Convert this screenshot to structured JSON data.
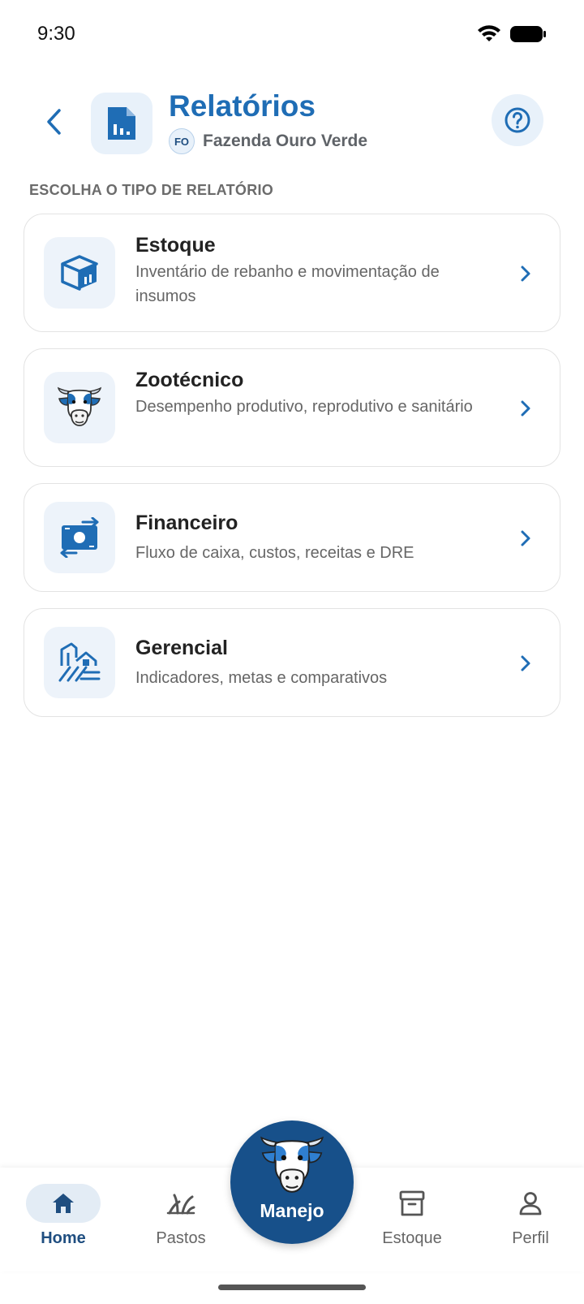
{
  "status_bar": {
    "time": "9:30"
  },
  "header": {
    "title": "Relatórios",
    "farm_initials": "FO",
    "farm_name": "Fazenda Ouro Verde"
  },
  "section_label": "ESCOLHA O TIPO DE RELATÓRIO",
  "cards": [
    {
      "title": "Estoque",
      "description": "Inventário de rebanho e movimentação de insumos",
      "icon": "inventory-box-icon"
    },
    {
      "title": "Zootécnico",
      "description": "Desempenho produtivo, reprodutivo e sanitário",
      "icon": "cow-icon"
    },
    {
      "title": "Financeiro",
      "description": "Fluxo de caixa, custos, receitas e DRE",
      "icon": "money-exchange-icon"
    },
    {
      "title": "Gerencial",
      "description": "Indicadores, metas e comparativos",
      "icon": "farm-building-icon"
    }
  ],
  "bottom_nav": {
    "home": "Home",
    "pastos": "Pastos",
    "manejo": "Manejo",
    "estoque": "Estoque",
    "perfil": "Perfil"
  },
  "colors": {
    "primary": "#1f6db5",
    "primary_dark": "#17508a",
    "icon_bg": "#edf3fa"
  }
}
